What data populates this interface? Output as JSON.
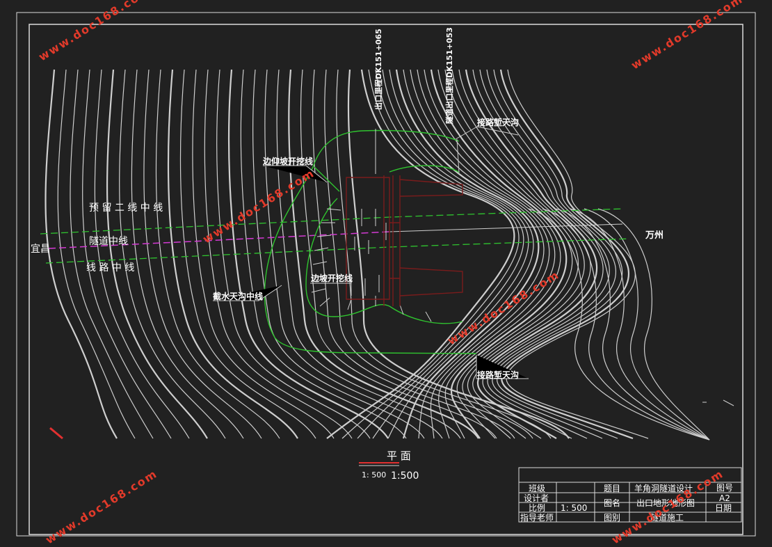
{
  "drawing": {
    "top_label_left": "出口里程DK151+065",
    "top_label_right": "隧道出口里程DK151+053",
    "left_town": "宜昌",
    "right_town": "万州",
    "line_reserved": "预 留 二 线 中 线",
    "line_tunnel": "隧道中线",
    "line_route": "线 路 中 线",
    "slope_upper": "边仰坡开挖线",
    "slope_lower": "边坡开挖线",
    "drain_center": "截水天沟中线",
    "drain_top": "接路堑天沟",
    "drain_bottom": "接路堑天沟",
    "view_title": "平 面",
    "scale_small": "1: 500",
    "scale_large": "1:500"
  },
  "title_block": {
    "class_label": "班级",
    "designer_label": "设计者",
    "scale_label": "比例",
    "scale_value": "1: 500",
    "advisor_label": "指导老师",
    "topic_label": "题目",
    "topic_value": "羊角洞隧道设计",
    "name_label": "图名",
    "name_value": "出口地形地形图",
    "type_label": "图别",
    "type_value": "隧道施工",
    "number_label": "图号",
    "number_value": "A2",
    "date_label": "日期"
  },
  "watermark": "www.doc168.com",
  "colors": {
    "background": "#212121",
    "contour": "#cfcfcf",
    "green": "#2fc42f",
    "magenta": "#d43ad4",
    "portal": "#7a1c1c",
    "watermark": "#e23a2a"
  }
}
